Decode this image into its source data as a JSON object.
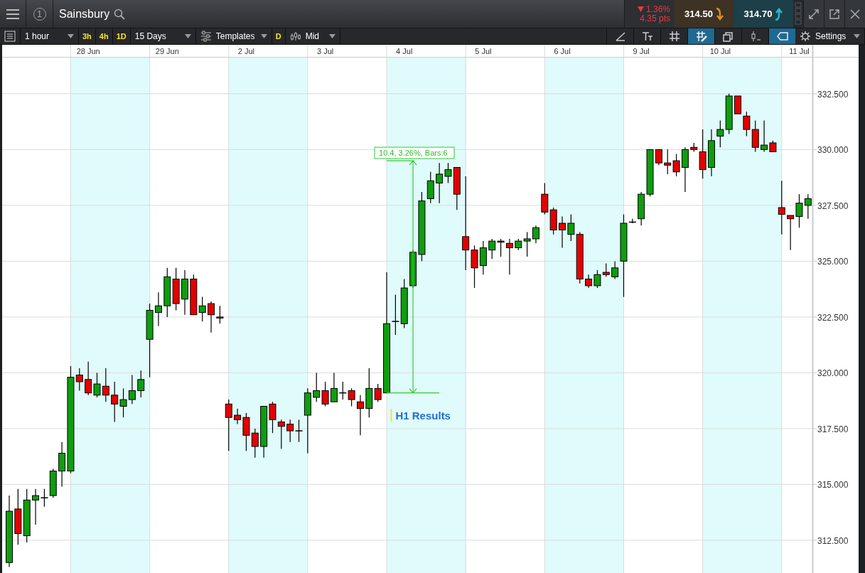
{
  "header": {
    "window_number": "1",
    "instrument": "Sainsbury",
    "change": {
      "falling": true,
      "percent": "1.36%",
      "points": "4.35 pts"
    },
    "sell": {
      "price": "314.50"
    },
    "buy": {
      "price": "314.70"
    }
  },
  "toolbar": {
    "interval": "1 hour",
    "quick_intervals": [
      {
        "label": "3h"
      },
      {
        "label": "4h"
      },
      {
        "label": "1D"
      }
    ],
    "range": "15 Days",
    "templates": "Templates",
    "price_badge": "D",
    "price_type": "Mid",
    "tools": [
      {
        "kind": "line",
        "selected": false
      },
      {
        "kind": "text",
        "selected": false
      },
      {
        "kind": "grid",
        "selected": false
      },
      {
        "kind": "grid-edit",
        "selected": true
      },
      {
        "kind": "windows",
        "selected": false
      },
      {
        "kind": "candle",
        "selected": false
      },
      {
        "kind": "tag",
        "selected": true
      }
    ],
    "settings": "Settings"
  },
  "chart": {
    "chart_data": {
      "type": "candlestick",
      "grid": true,
      "ylim": [
        311.0,
        334.12
      ],
      "categories": [
        null,
        null,
        null,
        null,
        null,
        null,
        null,
        null,
        null,
        "28 Jun",
        null,
        null,
        null,
        null,
        null,
        null,
        null,
        null,
        "29 Jun",
        null,
        null,
        null,
        null,
        null,
        null,
        null,
        null,
        "2 Jul",
        null,
        null,
        null,
        null,
        null,
        null,
        null,
        null,
        "3 Jul",
        null,
        null,
        null,
        null,
        null,
        null,
        null,
        null,
        "4 Jul",
        null,
        null,
        null,
        null,
        null,
        null,
        null,
        null,
        "5 Jul",
        null,
        null,
        null,
        null,
        null,
        null,
        null,
        null,
        "6 Jul",
        null,
        null,
        null,
        null,
        null,
        null,
        null,
        null,
        "9 Jul",
        null,
        null,
        null,
        null,
        null,
        null,
        null,
        null,
        "10 Jul",
        null,
        null,
        null,
        null,
        null,
        null,
        null,
        null,
        "11 Jul",
        null
      ],
      "yticks": [
        {
          "value": 312.5,
          "label": "312.500"
        },
        {
          "value": 315,
          "label": "315.000"
        },
        {
          "value": 317.5,
          "label": "317.500"
        },
        {
          "value": 320,
          "label": "320.000"
        },
        {
          "value": 322.5,
          "label": "322.500"
        },
        {
          "value": 325,
          "label": "325.000"
        },
        {
          "value": 327.5,
          "label": "327.500"
        },
        {
          "value": 330,
          "label": "330.000"
        },
        {
          "value": 332.5,
          "label": "332.500"
        }
      ],
      "ohlc": [
        [
          311.5,
          314.5,
          311.3,
          313.8
        ],
        [
          313.9,
          314.8,
          312.3,
          312.8
        ],
        [
          312.7,
          314.8,
          312.4,
          314.3
        ],
        [
          314.3,
          314.8,
          313.2,
          314.5
        ],
        [
          314.4,
          314.8,
          314.0,
          314.4
        ],
        [
          314.5,
          315.7,
          314.4,
          315.6
        ],
        [
          315.6,
          316.9,
          314.9,
          316.4
        ],
        [
          315.6,
          320.3,
          315.5,
          319.8
        ],
        [
          319.9,
          320.2,
          319.2,
          319.6
        ],
        [
          319.7,
          320.5,
          319.0,
          319.1
        ],
        [
          319.0,
          320.0,
          318.9,
          319.5
        ],
        [
          319.4,
          320.2,
          318.7,
          319.0
        ],
        [
          319.0,
          319.6,
          317.8,
          318.6
        ],
        [
          318.5,
          319.3,
          318.0,
          318.8
        ],
        [
          318.8,
          319.9,
          318.6,
          319.2
        ],
        [
          319.2,
          320.1,
          318.9,
          319.7
        ],
        [
          321.5,
          323.1,
          319.8,
          322.8
        ],
        [
          322.7,
          323.6,
          322.1,
          323.0
        ],
        [
          323.0,
          324.7,
          322.5,
          324.3
        ],
        [
          324.2,
          324.7,
          322.8,
          323.1
        ],
        [
          323.3,
          324.6,
          322.6,
          324.2
        ],
        [
          324.2,
          324.4,
          322.6,
          322.6
        ],
        [
          322.7,
          323.4,
          322.3,
          323.0
        ],
        [
          323.1,
          323.2,
          321.8,
          322.6
        ],
        [
          322.5,
          323.0,
          322.2,
          322.45
        ],
        [
          318.6,
          318.8,
          316.5,
          318.0
        ],
        [
          318.1,
          318.4,
          317.7,
          317.9
        ],
        [
          318.0,
          318.2,
          316.5,
          317.2
        ],
        [
          317.3,
          317.5,
          316.2,
          316.7
        ],
        [
          316.7,
          318.5,
          316.2,
          318.5
        ],
        [
          318.6,
          318.7,
          317.3,
          317.9
        ],
        [
          317.8,
          317.9,
          316.6,
          317.6
        ],
        [
          317.7,
          317.9,
          316.9,
          317.4
        ],
        [
          317.4,
          317.9,
          316.9,
          317.4
        ],
        [
          318.1,
          319.3,
          316.4,
          319.1
        ],
        [
          318.9,
          320.0,
          318.7,
          319.2
        ],
        [
          319.2,
          319.6,
          318.5,
          318.6
        ],
        [
          318.7,
          320.0,
          318.7,
          319.3
        ],
        [
          319.1,
          319.6,
          318.8,
          319.1
        ],
        [
          319.2,
          319.3,
          318.5,
          318.8
        ],
        [
          318.7,
          319.0,
          317.2,
          318.4
        ],
        [
          318.4,
          320.2,
          318.0,
          319.3
        ],
        [
          319.3,
          319.5,
          318.7,
          318.8
        ],
        [
          319.1,
          324.5,
          319.1,
          322.2
        ],
        [
          322.3,
          323.5,
          321.7,
          322.3
        ],
        [
          322.2,
          324.2,
          322.0,
          323.8
        ],
        [
          323.9,
          325.5,
          323.8,
          325.4
        ],
        [
          325.3,
          328.1,
          325.0,
          327.7
        ],
        [
          327.8,
          329.0,
          327.6,
          328.6
        ],
        [
          328.5,
          329.4,
          327.6,
          328.9
        ],
        [
          328.8,
          329.4,
          328.5,
          329.1
        ],
        [
          329.2,
          329.2,
          327.3,
          328.0
        ],
        [
          326.1,
          328.8,
          324.6,
          325.5
        ],
        [
          325.5,
          325.7,
          323.8,
          324.7
        ],
        [
          324.8,
          325.9,
          324.4,
          325.6
        ],
        [
          325.5,
          326.0,
          325.1,
          325.9
        ],
        [
          325.9,
          326.0,
          325.2,
          325.85
        ],
        [
          325.8,
          326.0,
          324.4,
          325.6
        ],
        [
          325.6,
          326.0,
          325.5,
          325.9
        ],
        [
          325.9,
          326.3,
          325.2,
          326.0
        ],
        [
          326.0,
          326.6,
          325.8,
          326.5
        ],
        [
          328.0,
          328.5,
          327.1,
          327.2
        ],
        [
          327.3,
          327.4,
          326.2,
          326.4
        ],
        [
          326.7,
          327.0,
          325.6,
          326.4
        ],
        [
          326.2,
          327.1,
          325.9,
          326.7
        ],
        [
          326.2,
          326.3,
          324.0,
          324.2
        ],
        [
          324.2,
          324.4,
          323.8,
          323.9
        ],
        [
          323.9,
          324.6,
          323.8,
          324.4
        ],
        [
          324.5,
          324.9,
          324.3,
          324.4
        ],
        [
          324.3,
          325.0,
          324.2,
          324.7
        ],
        [
          325.0,
          327.1,
          323.4,
          326.7
        ],
        [
          326.75,
          326.9,
          326.7,
          326.75
        ],
        [
          326.9,
          328.1,
          326.6,
          328.0
        ],
        [
          328.0,
          330.0,
          327.9,
          330.0
        ],
        [
          330.0,
          330.0,
          329.3,
          329.4
        ],
        [
          329.4,
          330.0,
          328.9,
          329.3
        ],
        [
          329.5,
          329.8,
          328.8,
          329.0
        ],
        [
          329.2,
          330.1,
          328.1,
          330.0
        ],
        [
          330.1,
          330.3,
          329.9,
          330.0
        ],
        [
          329.9,
          330.9,
          328.7,
          329.1
        ],
        [
          329.2,
          330.9,
          328.8,
          330.4
        ],
        [
          330.6,
          331.3,
          330.1,
          330.9
        ],
        [
          330.9,
          332.5,
          330.7,
          332.4
        ],
        [
          332.4,
          332.4,
          331.6,
          331.6
        ],
        [
          331.5,
          331.7,
          330.6,
          330.9
        ],
        [
          330.9,
          331.3,
          329.9,
          330.1
        ],
        [
          330.0,
          331.3,
          329.9,
          330.2
        ],
        [
          330.3,
          330.4,
          329.9,
          329.9
        ],
        [
          327.4,
          328.6,
          326.2,
          327.1
        ],
        [
          327.05,
          327.05,
          325.5,
          326.9
        ],
        [
          327.0,
          328.0,
          326.5,
          327.6
        ],
        [
          327.5,
          328.0,
          326.9,
          327.8
        ]
      ],
      "annotations": [
        "10.4, 3.26%, Bars:6",
        "H1 Results"
      ]
    }
  }
}
